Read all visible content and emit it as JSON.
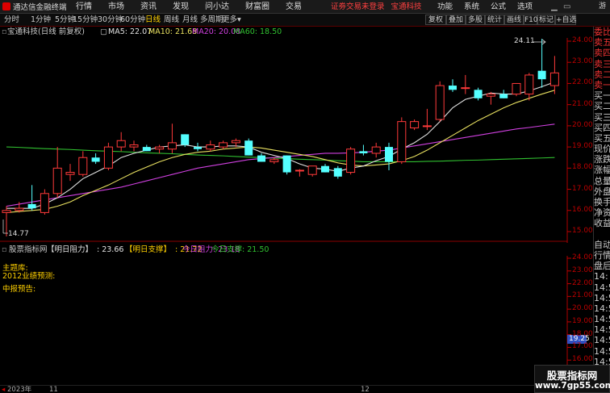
{
  "titlebar": {
    "app_title": "通达信金融终端",
    "menu": [
      "行情",
      "市场",
      "资讯",
      "发现",
      "问小达",
      "财富圈",
      "交易"
    ],
    "banner_left": "证劵交易未登录",
    "banner_right": "宝通科技",
    "system_buttons": [
      "功能",
      "系统",
      "公式",
      "选项"
    ],
    "guest_label": "游客"
  },
  "toolbar": {
    "periods": [
      "分时",
      "1分钟",
      "5分钟",
      "15分钟",
      "30分钟",
      "60分钟",
      "日线",
      "周线",
      "月线",
      "多周期",
      "更多"
    ],
    "more_arrow": "▾",
    "active_period": "日线",
    "right_buttons": [
      "复权",
      "叠加",
      "多股",
      "统计",
      "画线",
      "F10",
      "标记",
      "+自选"
    ]
  },
  "infobar": {
    "stock_name": "宝通科技(日线 前复权)",
    "ma5": "MA5: 22.07",
    "ma10": "MA10: 21.68",
    "ma20": "MA20: 20.08",
    "ma60": "MA60: 18.50"
  },
  "price_axis": {
    "ticks": [
      "24.00",
      "23.00",
      "22.00",
      "21.00",
      "20.00",
      "19.00",
      "18.00",
      "17.00",
      "16.00",
      "15.00"
    ],
    "high_marker": "24.11",
    "low_marker": "14.77"
  },
  "indicator": {
    "source_name": "股票指标网",
    "label_resistance_tomorrow": "【明日阻力】",
    "value_resistance_tomorrow": ": 23.66",
    "label_support_tomorrow": "【明日支撑】",
    "value_support_tomorrow": ": 21.72",
    "today_resistance": "今日阻力: 23.18",
    "today_support": "今日支撑: 21.50",
    "lines": [
      "主题库:",
      "2012业绩预测:",
      "中报预告:"
    ],
    "axis_ticks": [
      "24.00",
      "23.00",
      "22.00",
      "21.00",
      "20.00",
      "19.00",
      "18.00",
      "17.00",
      "16.00",
      "15.00"
    ],
    "current_value": "19.25"
  },
  "sidebar": {
    "items": [
      "委比",
      "卖五",
      "卖四",
      "卖三",
      "卖二",
      "卖一",
      "买一",
      "买二",
      "买三",
      "买四",
      "买五",
      "现价",
      "涨跌",
      "涨幅",
      "总量",
      "外盘",
      "换手",
      "净资",
      "收益",
      "",
      "自动",
      "行情",
      "盘后",
      "14:",
      "14:5",
      "14:5",
      "14:5",
      "14:5",
      "14:5",
      "14:5",
      "14:5",
      "14:5",
      "14:5"
    ],
    "red_items": [
      0,
      1,
      2,
      3,
      4,
      5
    ]
  },
  "bottom_bar": {
    "year": "2023年",
    "month_11": "11",
    "month_12": "12"
  },
  "watermark": {
    "line1": "股票指标网",
    "line2": "www.7gp55.com"
  },
  "colors": {
    "up_candle": "#ff3a3a",
    "down_candle": "#54ffff",
    "ma5": "#e0e0e0",
    "ma10": "#e8e060",
    "ma20": "#d040e0",
    "ma60": "#30c030",
    "axis": "#c00000"
  },
  "chart_data": {
    "type": "candlestick",
    "y_axis": [
      15.0,
      24.0
    ],
    "candles": [
      {
        "o": 15.9,
        "h": 16.2,
        "l": 14.77,
        "c": 16.0
      },
      {
        "o": 16.0,
        "h": 16.4,
        "l": 15.9,
        "c": 16.1
      },
      {
        "o": 16.3,
        "h": 17.2,
        "l": 16.0,
        "c": 16.1
      },
      {
        "o": 15.9,
        "h": 17.0,
        "l": 15.8,
        "c": 16.8
      },
      {
        "o": 16.8,
        "h": 19.0,
        "l": 16.6,
        "c": 18.0
      },
      {
        "o": 17.7,
        "h": 18.2,
        "l": 17.4,
        "c": 17.8
      },
      {
        "o": 17.7,
        "h": 18.8,
        "l": 17.6,
        "c": 18.5
      },
      {
        "o": 18.5,
        "h": 18.7,
        "l": 18.2,
        "c": 18.3
      },
      {
        "o": 18.0,
        "h": 19.2,
        "l": 17.9,
        "c": 19.0
      },
      {
        "o": 19.0,
        "h": 19.7,
        "l": 18.8,
        "c": 19.3
      },
      {
        "o": 19.0,
        "h": 19.3,
        "l": 18.8,
        "c": 19.1
      },
      {
        "o": 19.0,
        "h": 19.1,
        "l": 18.8,
        "c": 18.8
      },
      {
        "o": 18.9,
        "h": 19.1,
        "l": 18.7,
        "c": 19.0
      },
      {
        "o": 18.9,
        "h": 20.1,
        "l": 18.7,
        "c": 19.2
      },
      {
        "o": 19.6,
        "h": 19.6,
        "l": 19.0,
        "c": 19.1
      },
      {
        "o": 19.0,
        "h": 19.2,
        "l": 18.8,
        "c": 18.9
      },
      {
        "o": 18.9,
        "h": 19.3,
        "l": 18.8,
        "c": 19.1
      },
      {
        "o": 19.0,
        "h": 19.3,
        "l": 18.9,
        "c": 19.2
      },
      {
        "o": 19.2,
        "h": 19.4,
        "l": 19.0,
        "c": 19.3
      },
      {
        "o": 19.3,
        "h": 19.4,
        "l": 18.6,
        "c": 18.6
      },
      {
        "o": 18.6,
        "h": 18.7,
        "l": 18.3,
        "c": 18.3
      },
      {
        "o": 18.3,
        "h": 18.5,
        "l": 18.2,
        "c": 18.4
      },
      {
        "o": 18.6,
        "h": 18.6,
        "l": 17.7,
        "c": 17.8
      },
      {
        "o": 17.9,
        "h": 17.95,
        "l": 17.6,
        "c": 17.9
      },
      {
        "o": 17.7,
        "h": 18.1,
        "l": 17.6,
        "c": 18.1
      },
      {
        "o": 18.1,
        "h": 18.2,
        "l": 17.8,
        "c": 17.8
      },
      {
        "o": 18.0,
        "h": 18.1,
        "l": 17.5,
        "c": 17.6
      },
      {
        "o": 17.8,
        "h": 19.0,
        "l": 17.7,
        "c": 18.9
      },
      {
        "o": 18.8,
        "h": 19.1,
        "l": 18.6,
        "c": 18.7
      },
      {
        "o": 18.7,
        "h": 19.2,
        "l": 18.5,
        "c": 19.0
      },
      {
        "o": 19.0,
        "h": 19.2,
        "l": 17.9,
        "c": 18.3
      },
      {
        "o": 18.3,
        "h": 20.4,
        "l": 18.2,
        "c": 20.2
      },
      {
        "o": 19.9,
        "h": 20.3,
        "l": 19.8,
        "c": 20.2
      },
      {
        "o": 20.0,
        "h": 20.8,
        "l": 19.8,
        "c": 20.0
      },
      {
        "o": 20.3,
        "h": 22.1,
        "l": 20.2,
        "c": 21.9
      },
      {
        "o": 21.9,
        "h": 22.2,
        "l": 21.6,
        "c": 21.7
      },
      {
        "o": 21.8,
        "h": 22.4,
        "l": 21.5,
        "c": 21.8
      },
      {
        "o": 21.7,
        "h": 21.8,
        "l": 21.2,
        "c": 21.3
      },
      {
        "o": 21.4,
        "h": 21.6,
        "l": 21.0,
        "c": 21.5
      },
      {
        "o": 21.5,
        "h": 21.7,
        "l": 21.3,
        "c": 21.3
      },
      {
        "o": 21.5,
        "h": 22.0,
        "l": 21.4,
        "c": 22.0
      },
      {
        "o": 21.5,
        "h": 22.5,
        "l": 21.2,
        "c": 22.4
      },
      {
        "o": 22.6,
        "h": 24.11,
        "l": 21.8,
        "c": 22.2
      },
      {
        "o": 21.9,
        "h": 23.3,
        "l": 21.5,
        "c": 22.5
      }
    ],
    "ma5": [
      16.1,
      16.1,
      16.1,
      16.3,
      16.6,
      17.0,
      17.5,
      17.8,
      18.1,
      18.5,
      18.7,
      18.85,
      19.0,
      19.05,
      19.1,
      19.0,
      19.0,
      19.05,
      19.05,
      19.0,
      18.75,
      18.6,
      18.45,
      18.2,
      18.0,
      17.95,
      17.85,
      18.0,
      18.1,
      18.35,
      18.55,
      18.9,
      19.2,
      19.6,
      20.2,
      20.85,
      21.25,
      21.4,
      21.55,
      21.5,
      21.5,
      21.65,
      21.85,
      22.07
    ],
    "ma10": [
      15.9,
      15.95,
      16.0,
      16.05,
      16.2,
      16.4,
      16.7,
      16.95,
      17.2,
      17.5,
      17.8,
      18.05,
      18.3,
      18.5,
      18.65,
      18.75,
      18.8,
      18.9,
      18.95,
      19.0,
      18.95,
      18.85,
      18.75,
      18.65,
      18.55,
      18.4,
      18.25,
      18.15,
      18.1,
      18.15,
      18.2,
      18.35,
      18.55,
      18.85,
      19.2,
      19.55,
      19.9,
      20.25,
      20.55,
      20.85,
      21.1,
      21.3,
      21.5,
      21.68
    ],
    "ma20": [
      16.2,
      16.3,
      16.4,
      16.5,
      16.6,
      16.7,
      16.8,
      16.9,
      17.0,
      17.1,
      17.25,
      17.4,
      17.55,
      17.7,
      17.85,
      18.0,
      18.1,
      18.2,
      18.3,
      18.4,
      18.45,
      18.5,
      18.55,
      18.6,
      18.65,
      18.7,
      18.7,
      18.72,
      18.75,
      18.8,
      18.85,
      18.95,
      19.05,
      19.15,
      19.25,
      19.35,
      19.45,
      19.55,
      19.65,
      19.75,
      19.85,
      19.92,
      20.0,
      20.08
    ],
    "ma60": [
      19.0,
      18.98,
      18.95,
      18.92,
      18.9,
      18.88,
      18.85,
      18.82,
      18.8,
      18.78,
      18.75,
      18.72,
      18.7,
      18.68,
      18.65,
      18.62,
      18.6,
      18.58,
      18.55,
      18.52,
      18.5,
      18.47,
      18.45,
      18.42,
      18.4,
      18.38,
      18.35,
      18.33,
      18.3,
      18.3,
      18.3,
      18.3,
      18.3,
      18.32,
      18.33,
      18.35,
      18.37,
      18.38,
      18.4,
      18.42,
      18.44,
      18.46,
      18.48,
      18.5
    ]
  }
}
